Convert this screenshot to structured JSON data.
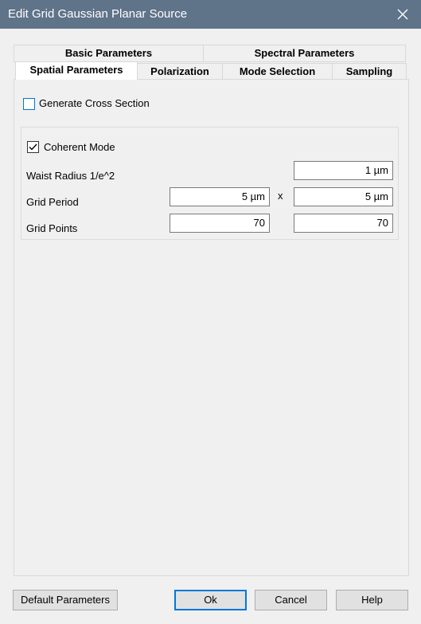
{
  "window": {
    "title": "Edit Grid Gaussian Planar Source",
    "close_glyph": "✕"
  },
  "tabs": {
    "row1": [
      "Basic Parameters",
      "Spectral Parameters"
    ],
    "row2": [
      "Spatial Parameters",
      "Polarization",
      "Mode Selection",
      "Sampling"
    ],
    "active": "Spatial Parameters"
  },
  "spatial": {
    "generate_cross_section": {
      "label": "Generate Cross Section",
      "checked": false
    },
    "coherent_mode": {
      "label": "Coherent Mode",
      "checked": true
    },
    "waist_radius": {
      "label": "Waist Radius 1/e^2",
      "value": "1 µm"
    },
    "grid_period": {
      "label": "Grid Period",
      "x_value": "5 µm",
      "separator": "x",
      "y_value": "5 µm"
    },
    "grid_points": {
      "label": "Grid Points",
      "x_value": "70",
      "y_value": "70"
    }
  },
  "buttons": {
    "default_parameters": "Default Parameters",
    "ok": "Ok",
    "cancel": "Cancel",
    "help": "Help"
  },
  "colors": {
    "titlebar": "#5f7389",
    "accent": "#0078d7"
  }
}
